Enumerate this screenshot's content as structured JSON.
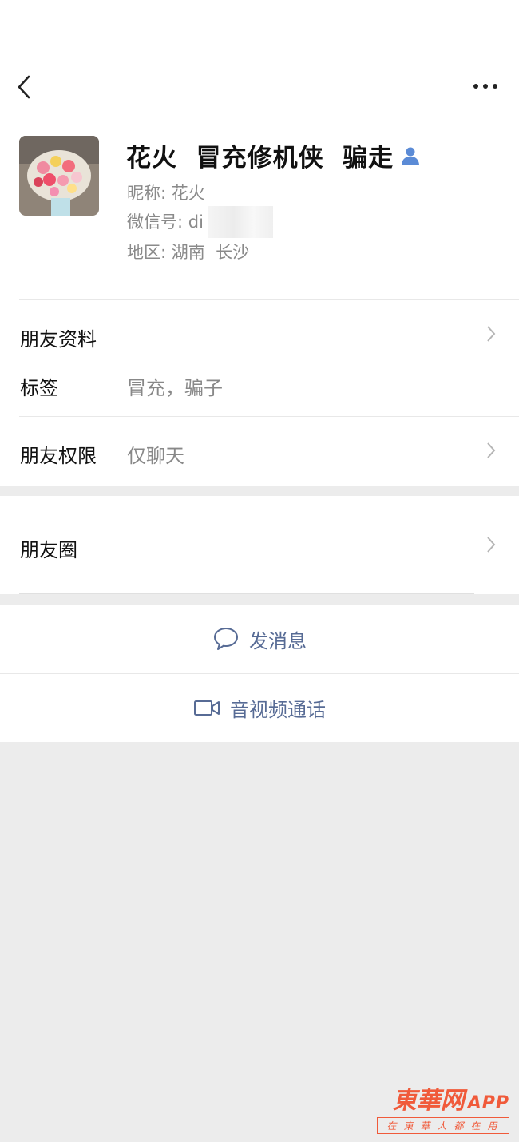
{
  "header": {
    "back_icon": "chevron-left-icon",
    "more_icon": "more-dots-icon"
  },
  "profile": {
    "name": "花火  冒充修机侠  骗走",
    "nickname_line": "昵称: 花火",
    "wechat_id_line": "微信号: di",
    "region_line": "地区: 湖南  长沙",
    "badge_icon": "person-icon"
  },
  "rows": {
    "friend_info": "朋友资料",
    "tags_label": "标签",
    "tags_value": "冒充，骗子",
    "permission_label": "朋友权限",
    "permission_value": "仅聊天",
    "moments": "朋友圈"
  },
  "actions": {
    "message": "发消息",
    "call": "音视频通话"
  },
  "watermark": {
    "brand": "東華网",
    "app": "APP",
    "slogan": "在東華人都在用"
  },
  "colors": {
    "link": "#576b95",
    "background": "#ececec",
    "watermark": "#f05a3a"
  }
}
